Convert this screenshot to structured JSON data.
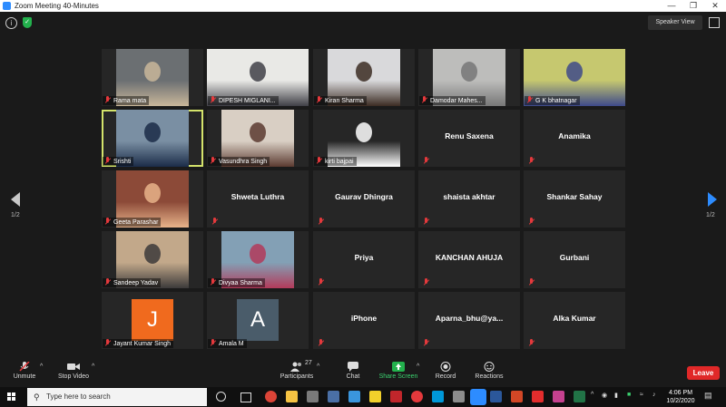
{
  "window": {
    "title": "Zoom Meeting 40-Minutes"
  },
  "meeting_bar": {
    "speaker_view": "Speaker View"
  },
  "pagination": {
    "left": "1/2",
    "right": "1/2"
  },
  "participants": [
    {
      "name": "Rama mata",
      "kind": "video",
      "bg": "#6b6f72",
      "accent": "#c9b79a"
    },
    {
      "name": "DIPESH MIGLANI...",
      "kind": "video",
      "bg": "#e9e9e6",
      "accent": "#3f3f46"
    },
    {
      "name": "Kiran Sharma",
      "kind": "video",
      "bg": "#d9d9db",
      "accent": "#3b2b22"
    },
    {
      "name": "Damodar Mahes...",
      "kind": "video",
      "bg": "#bdbdbb",
      "accent": "#777"
    },
    {
      "name": "G K bhatnagar",
      "kind": "video",
      "bg": "#c6c86f",
      "accent": "#3e4a8a"
    },
    {
      "name": "Srishti",
      "kind": "video",
      "bg": "#7a8fa3",
      "accent": "#1b2c48",
      "active": true
    },
    {
      "name": "Vasundhra Singh",
      "kind": "video",
      "bg": "#d9cfc4",
      "accent": "#5b3a30"
    },
    {
      "name": "kirti bajpai",
      "kind": "video",
      "bg": "#262626",
      "accent": "#ffffff"
    },
    {
      "name": "Renu Saxena",
      "kind": "name"
    },
    {
      "name": "Anamika",
      "kind": "name"
    },
    {
      "name": "Geeta Parashar",
      "kind": "video",
      "bg": "#8c4a38",
      "accent": "#e8b38a"
    },
    {
      "name": "Shweta Luthra",
      "kind": "name"
    },
    {
      "name": "Gaurav Dhingra",
      "kind": "name"
    },
    {
      "name": "shaista akhtar",
      "kind": "name"
    },
    {
      "name": "Shankar Sahay",
      "kind": "name"
    },
    {
      "name": "Sandeep Yadav",
      "kind": "video",
      "bg": "#c2a88a",
      "accent": "#3c3a3a"
    },
    {
      "name": "Divyaa Sharma",
      "kind": "video",
      "bg": "#83a0b5",
      "accent": "#b33a5a"
    },
    {
      "name": "Priya",
      "kind": "name"
    },
    {
      "name": "KANCHAN AHUJA",
      "kind": "name"
    },
    {
      "name": "Gurbani",
      "kind": "name"
    },
    {
      "name": "Jayant Kumar Singh",
      "kind": "avatar",
      "letter": "J",
      "color": "#f06a1e"
    },
    {
      "name": "Amala M",
      "kind": "avatar",
      "letter": "A",
      "color": "#4a5c6a"
    },
    {
      "name": "iPhone",
      "kind": "name"
    },
    {
      "name": "Aparna_bhu@ya...",
      "kind": "name"
    },
    {
      "name": "Alka Kumar",
      "kind": "name"
    }
  ],
  "toolbar": {
    "unmute": "Unmute",
    "stop_video": "Stop Video",
    "participants": "Participants",
    "participants_count": "27",
    "chat": "Chat",
    "share_screen": "Share Screen",
    "record": "Record",
    "reactions": "Reactions",
    "leave": "Leave"
  },
  "taskbar": {
    "search_placeholder": "Type here to search",
    "time": "4:06 PM",
    "date": "10/2/2020"
  }
}
